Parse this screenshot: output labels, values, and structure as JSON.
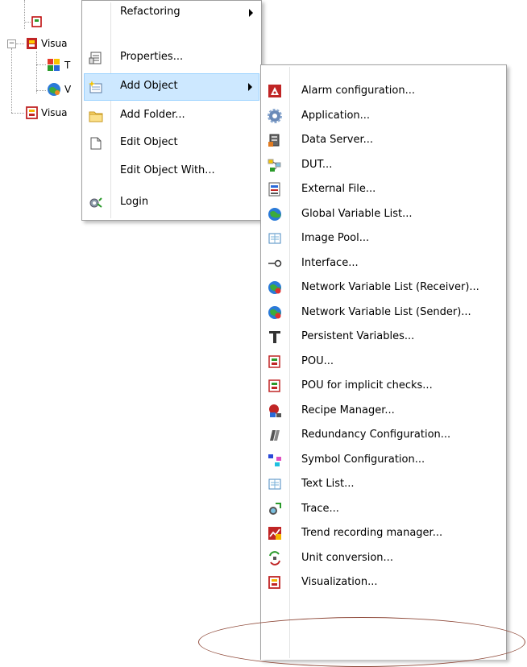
{
  "tree": {
    "nodes": [
      {
        "label": "Visua",
        "icon": "visualization-folder-icon"
      },
      {
        "label": "T",
        "icon": "texture-icon"
      },
      {
        "label": "V",
        "icon": "globe-icon"
      },
      {
        "label": "Visua",
        "icon": "visualization-icon"
      }
    ]
  },
  "context_menu": {
    "items": [
      {
        "label": "Refactoring",
        "icon": "",
        "submenu": true
      },
      {
        "label": "Properties...",
        "icon": "properties-icon",
        "submenu": false
      },
      {
        "label": "Add Object",
        "icon": "add-object-icon",
        "submenu": true,
        "highlighted": true
      },
      {
        "label": "Add Folder...",
        "icon": "folder-icon",
        "submenu": false
      },
      {
        "label": "Edit Object",
        "icon": "edit-object-icon",
        "submenu": false
      },
      {
        "label": "Edit Object With...",
        "icon": "",
        "submenu": false
      },
      {
        "label": "Login",
        "icon": "login-icon",
        "submenu": false
      }
    ]
  },
  "add_object_menu": {
    "items": [
      {
        "label": "Alarm configuration...",
        "icon": "alarm-icon"
      },
      {
        "label": "Application...",
        "icon": "application-gear-icon"
      },
      {
        "label": "Data Server...",
        "icon": "data-server-icon"
      },
      {
        "label": "DUT...",
        "icon": "dut-icon"
      },
      {
        "label": "External File...",
        "icon": "external-file-icon"
      },
      {
        "label": "Global Variable List...",
        "icon": "global-variable-list-icon"
      },
      {
        "label": "Image Pool...",
        "icon": "image-pool-icon"
      },
      {
        "label": "Interface...",
        "icon": "interface-icon"
      },
      {
        "label": "Network Variable List (Receiver)...",
        "icon": "network-variable-receiver-icon"
      },
      {
        "label": "Network Variable List (Sender)...",
        "icon": "network-variable-sender-icon"
      },
      {
        "label": "Persistent Variables...",
        "icon": "persistent-variables-icon"
      },
      {
        "label": "POU...",
        "icon": "pou-icon"
      },
      {
        "label": "POU for implicit checks...",
        "icon": "pou-implicit-checks-icon"
      },
      {
        "label": "Recipe Manager...",
        "icon": "recipe-manager-icon"
      },
      {
        "label": "Redundancy Configuration...",
        "icon": "redundancy-icon"
      },
      {
        "label": "Symbol Configuration...",
        "icon": "symbol-configuration-icon"
      },
      {
        "label": "Text List...",
        "icon": "text-list-icon"
      },
      {
        "label": "Trace...",
        "icon": "trace-icon"
      },
      {
        "label": "Trend recording manager...",
        "icon": "trend-recording-icon"
      },
      {
        "label": "Unit conversion...",
        "icon": "unit-conversion-icon"
      },
      {
        "label": "Visualization...",
        "icon": "visualization-icon"
      }
    ]
  },
  "colors": {
    "highlight_bg": "#cde8ff",
    "highlight_border": "#99d1ff",
    "annotation_ellipse": "#8f4a3a"
  }
}
